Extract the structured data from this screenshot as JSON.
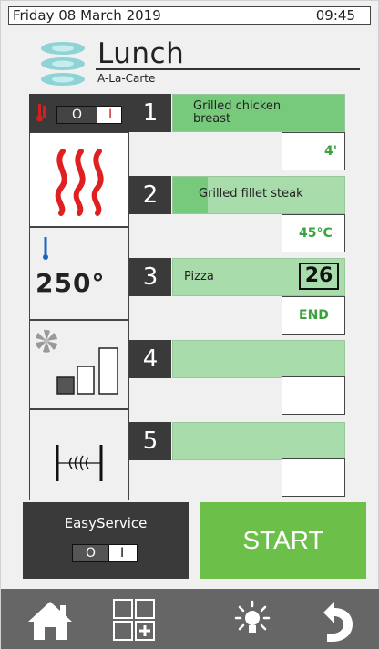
{
  "status": {
    "date": "Friday 08 March 2019",
    "time": "09:45"
  },
  "header": {
    "title": "Lunch",
    "subtitle": "A-La-Carte",
    "logo_icon": "stacked-plates-icon"
  },
  "side_tiles": {
    "heat_toggle": {
      "off_label": "O",
      "on_label": "I",
      "icon": "thermometer-red-icon"
    },
    "heating_icon": "heat-waves-icon",
    "temperature": {
      "value": "250°",
      "icon": "thermometer-blue-icon"
    },
    "fan": {
      "icon": "fan-speed-icon"
    },
    "steam": {
      "icon": "steam-damper-icon"
    }
  },
  "steps": [
    {
      "number": "1",
      "name": "Grilled chicken breast",
      "value": "4'",
      "progress": 1.0
    },
    {
      "number": "2",
      "name": "Grilled fillet steak",
      "value": "45°C",
      "progress": 0.2
    },
    {
      "number": "3",
      "name": "Pizza",
      "value": "END",
      "countdown": "26",
      "progress": 0.0
    },
    {
      "number": "4",
      "name": "",
      "value": "",
      "progress": 0.0
    },
    {
      "number": "5",
      "name": "",
      "value": "",
      "progress": 0.0
    }
  ],
  "easyservice": {
    "label": "EasyService",
    "off_label": "O",
    "on_label": "I"
  },
  "start": {
    "label": "START"
  },
  "nav": {
    "home": "home-icon",
    "grid": "add-program-grid-icon",
    "light": "light-bulb-icon",
    "back": "back-arrow-icon"
  },
  "colors": {
    "accent_green": "#6cc049",
    "bar_green": "#a8dcaa",
    "progress_green": "#77c97b",
    "dark_tile": "#3a3a3a",
    "navbar": "#666666"
  }
}
